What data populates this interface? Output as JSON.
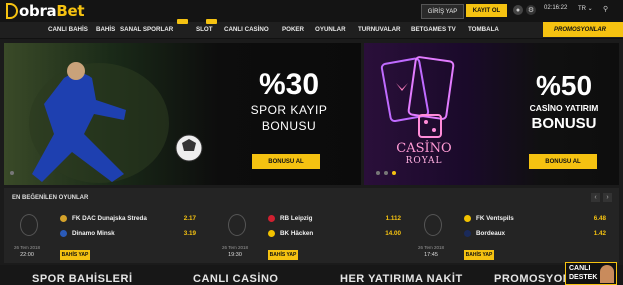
{
  "brand": {
    "name_left": "D",
    "name_main": "obra",
    "name_accent": "Bet"
  },
  "header": {
    "login_label": "GİRİŞ YAP",
    "signup_label": "KAYIT OL",
    "time": "02:16:22",
    "lang": "TR ⌄"
  },
  "nav": {
    "items": [
      "CANLI BAHİS",
      "BAHİS",
      "SANAL SPORLAR",
      "SLOT",
      "CANLI CASİNO",
      "POKER",
      "OYUNLAR",
      "TURNUVALAR",
      "BETGAMES TV",
      "TOMBALA"
    ],
    "promo_label": "PROMOSYONLAR"
  },
  "banners": [
    {
      "big": "%30",
      "line1": "SPOR KAYIP",
      "line2": "BONUSU",
      "cta": "BONUSU AL"
    },
    {
      "big": "%50",
      "line1": "CASİNO YATIRIM",
      "line2": "BONUSU",
      "cta": "BONUSU AL",
      "neon1": "CASİNO",
      "neon2": "ROYAL"
    }
  ],
  "popular": {
    "title": "EN BEĞENİLEN OYUNLAR",
    "matches": [
      {
        "home": "FK DAC Dunajska Streda",
        "away": "Dinamo Minsk",
        "home_odd": "2.17",
        "away_odd": "3.19",
        "date": "26 Tem 2018",
        "time": "22:00",
        "cta": "BAHİS YAP"
      },
      {
        "home": "RB Leipzig",
        "away": "BK Häcken",
        "home_odd": "1.112",
        "away_odd": "14.00",
        "date": "26 Tem 2018",
        "time": "19:30",
        "cta": "BAHİS YAP"
      },
      {
        "home": "FK Ventspils",
        "away": "Bordeaux",
        "home_odd": "6.48",
        "away_odd": "1.42",
        "date": "26 Tem 2018",
        "time": "17:45",
        "cta": "BAHİS YAP"
      }
    ]
  },
  "footer_titles": [
    "SPOR BAHİSLERİ",
    "CANLI CASİNO",
    "HER YATIRIMA NAKİT",
    "PROMOSYON"
  ],
  "live_support": {
    "line1": "CANLI",
    "line2": "DESTEK"
  },
  "colors": {
    "accent": "#f5c211",
    "bg": "#1b1b1b"
  }
}
